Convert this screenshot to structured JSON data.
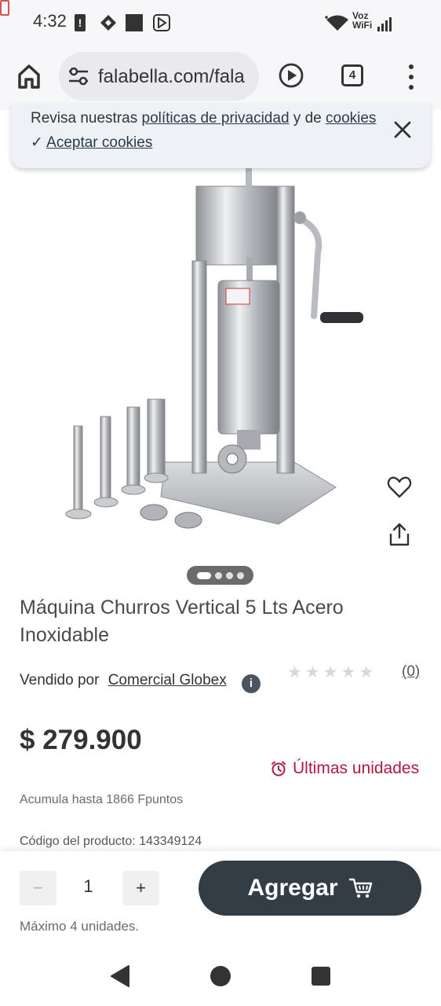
{
  "status_bar": {
    "time": "4:32",
    "network_label_top": "Voz",
    "network_label_bottom": "WiFi"
  },
  "browser": {
    "url": "falabella.com/fala",
    "tab_count": "4"
  },
  "cookie_banner": {
    "text_prefix": "Revisa nuestras ",
    "privacy_link": "políticas de privacidad",
    "text_middle": " y de ",
    "cookies_link": "cookies",
    "accept_check": "✓",
    "accept_label": "Aceptar cookies"
  },
  "carousel": {
    "total_images": 4,
    "active_index": 0
  },
  "product": {
    "title": "Máquina Churros Vertical 5 Lts Acero Inoxidable",
    "sold_by_label": "Vendido por",
    "seller": "Comercial Globex",
    "info_glyph": "i",
    "rating": 0,
    "review_count": "(0)",
    "price": "$ 279.900",
    "stock_alert": "Últimas unidades",
    "points_text": "Acumula hasta 1866 Fpuntos",
    "product_code": "Código del producto: 143349124"
  },
  "add_bar": {
    "minus_label": "−",
    "quantity": "1",
    "plus_label": "+",
    "max_text": "Máximo 4 unidades.",
    "add_label": "Agregar"
  },
  "colors": {
    "accent": "#333d46",
    "alert": "#b1193e",
    "background": "#ffffff"
  },
  "icons": {
    "status": [
      "alert-icon",
      "assistant-icon",
      "square-icon",
      "play-store-icon",
      "wifi-icon",
      "signal-icon",
      "battery-icon"
    ],
    "browser": [
      "home-icon",
      "tune-icon",
      "play-circle-icon",
      "tabs-icon",
      "more-vert-icon"
    ],
    "page": [
      "close-icon",
      "heart-icon",
      "share-icon",
      "info-icon",
      "clock-icon",
      "cart-icon"
    ],
    "nav": [
      "back-icon",
      "home-circle-icon",
      "recents-icon"
    ]
  }
}
